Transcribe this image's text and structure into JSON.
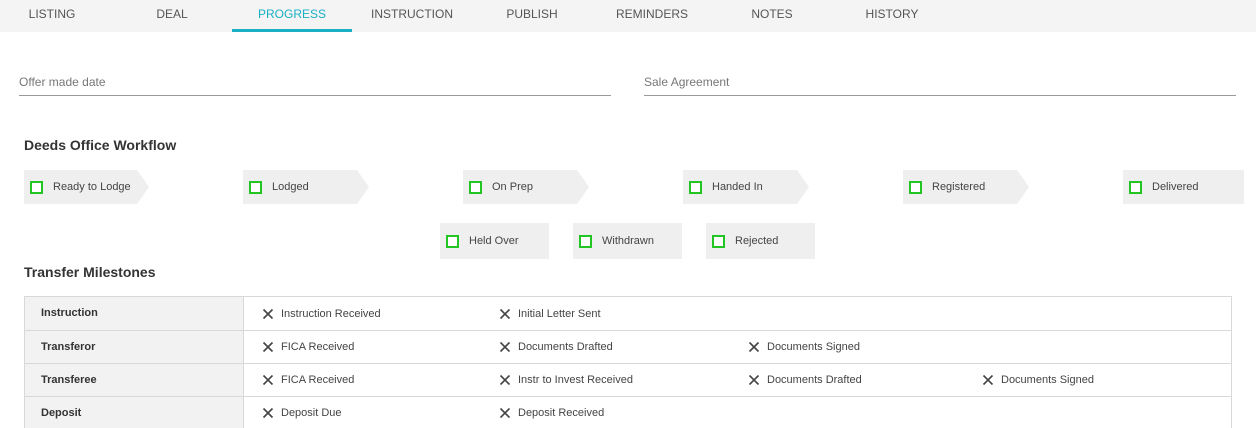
{
  "tabs": [
    {
      "label": "LISTING"
    },
    {
      "label": "DEAL"
    },
    {
      "label": "PROGRESS",
      "active": true
    },
    {
      "label": "INSTRUCTION"
    },
    {
      "label": "PUBLISH"
    },
    {
      "label": "REMINDERS"
    },
    {
      "label": "NOTES"
    },
    {
      "label": "HISTORY"
    }
  ],
  "form": {
    "offer_made_date": {
      "placeholder": "Offer made date",
      "value": ""
    },
    "sale_agreement": {
      "placeholder": "Sale Agreement",
      "value": ""
    }
  },
  "deeds_workflow": {
    "title": "Deeds Office Workflow",
    "steps": [
      "Ready to Lodge",
      "Lodged",
      "On Prep",
      "Handed In",
      "Registered",
      "Delivered"
    ],
    "other_statuses": [
      "Held Over",
      "Withdrawn",
      "Rejected"
    ]
  },
  "transfer_milestones": {
    "title": "Transfer Milestones",
    "rows": [
      {
        "label": "Instruction",
        "items": [
          "Instruction Received",
          "Initial Letter Sent"
        ]
      },
      {
        "label": "Transferor",
        "items": [
          "FICA Received",
          "Documents Drafted",
          "Documents Signed"
        ]
      },
      {
        "label": "Transferee",
        "items": [
          "FICA Received",
          "Instr to Invest Received",
          "Documents Drafted",
          "Documents Signed"
        ]
      },
      {
        "label": "Deposit",
        "items": [
          "Deposit Due",
          "Deposit Received"
        ]
      }
    ]
  },
  "colors": {
    "accent": "#1aafc4",
    "checkbox_border": "#22c522",
    "tab_bar_bg": "#f4f4f4",
    "chevron_bg": "#efefef"
  },
  "icons": {
    "milestone_status": "close-x-icon",
    "workflow_status": "checkbox-icon"
  }
}
